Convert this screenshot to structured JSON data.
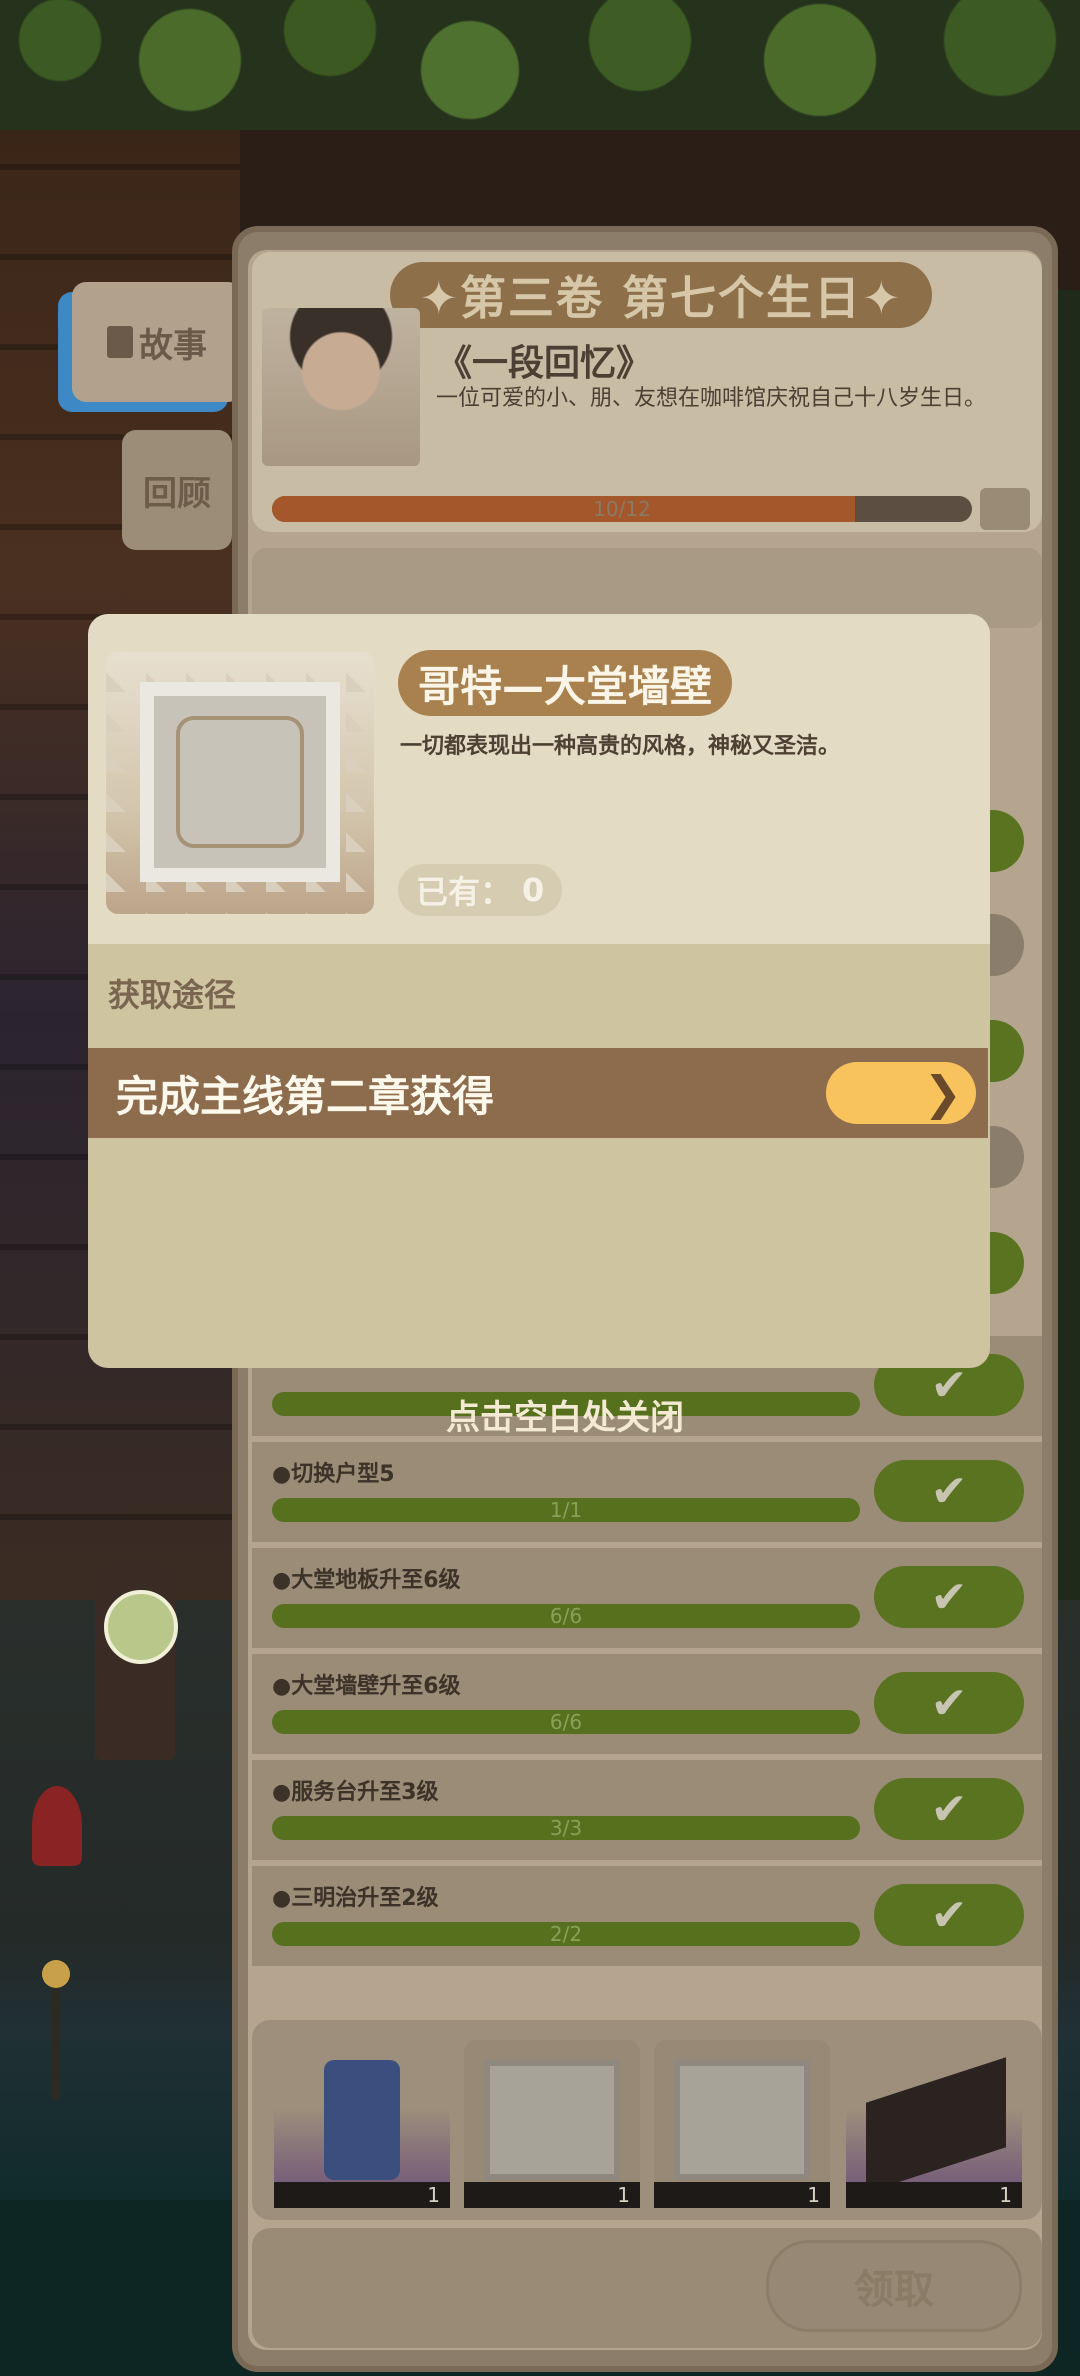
{
  "side_tabs": {
    "story": "故事",
    "review": "回顾"
  },
  "panel": {
    "chapter_title": "✦第三卷 第七个生日✦",
    "story_title": "《一段回忆》",
    "story_desc": "一位可爱的小、朋、友想在咖啡馆庆祝自己十八岁生日。",
    "progress_text": "10/12",
    "progress_fraction": 0.833,
    "tasks": [
      {
        "label": "●切换户型5",
        "count": "1/1"
      },
      {
        "label": "●大堂地板升至6级",
        "count": "6/6"
      },
      {
        "label": "●大堂墙壁升至6级",
        "count": "6/6"
      },
      {
        "label": "●服务台升至3级",
        "count": "3/3"
      },
      {
        "label": "●三明治升至2级",
        "count": "2/2"
      }
    ],
    "done_icon": "✔",
    "rewards": [
      {
        "icon": "potion-bottle-icon",
        "qty": "1"
      },
      {
        "icon": "wall-panel-icon",
        "qty": "1"
      },
      {
        "icon": "wall-panel-icon",
        "qty": "1"
      },
      {
        "icon": "chocolate-cake-icon",
        "qty": "1"
      }
    ],
    "claim_label": "领取"
  },
  "close_hint": "点击空白处关闭",
  "item_modal": {
    "name": "哥特—大堂墙壁",
    "description": "一切都表现出一种高贵的风格，神秘又圣洁。",
    "owned_label": "已有：",
    "owned_value": "0",
    "source_heading": "获取途径",
    "source_text": "完成主线第二章获得",
    "go_icon": "❯"
  },
  "colors": {
    "accent_gold": "#a8814f",
    "go_button": "#f8c35c",
    "source_row": "#8d6b4d",
    "progress_fill": "#a4572a",
    "done_green": "#5a7321"
  }
}
